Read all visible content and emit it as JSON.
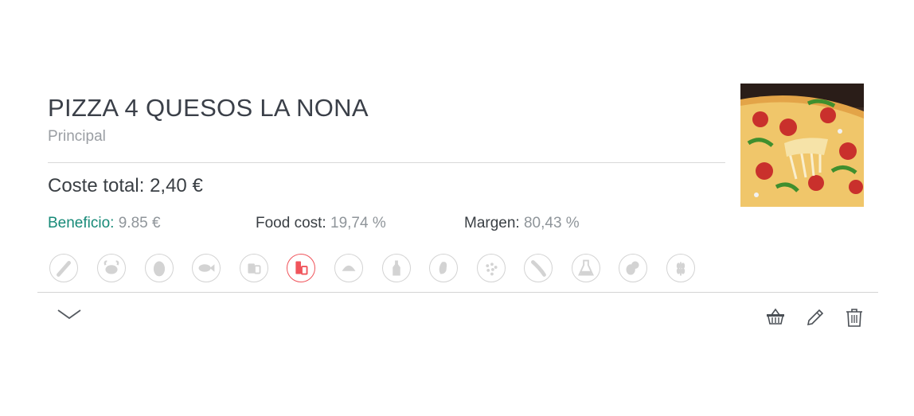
{
  "recipe": {
    "title": "PIZZA 4 QUESOS LA NONA",
    "category": "Principal",
    "total_cost_label": "Coste total: 2,40 €"
  },
  "metrics": [
    {
      "label": "Beneficio:",
      "value": "9.85 €"
    },
    {
      "label": "Food cost:",
      "value": "19,74 %"
    },
    {
      "label": "Margen:",
      "value": "80,43 %"
    }
  ],
  "allergens": [
    {
      "icon": "celery-icon",
      "active": false
    },
    {
      "icon": "crustaceans-icon",
      "active": false
    },
    {
      "icon": "egg-icon",
      "active": false
    },
    {
      "icon": "fish-icon",
      "active": false
    },
    {
      "icon": "sulphites-icon",
      "active": false
    },
    {
      "icon": "milk-icon",
      "active": true
    },
    {
      "icon": "molluscs-icon",
      "active": false
    },
    {
      "icon": "mustard-icon",
      "active": false
    },
    {
      "icon": "nuts-icon",
      "active": false
    },
    {
      "icon": "sesame-icon",
      "active": false
    },
    {
      "icon": "lupin-icon",
      "active": false
    },
    {
      "icon": "soy-icon",
      "active": false
    },
    {
      "icon": "peanut-icon",
      "active": false
    },
    {
      "icon": "gluten-icon",
      "active": false
    }
  ],
  "colors": {
    "accent": "#178a78",
    "active_allergen": "#f0545b",
    "inactive_allergen": "#d3d3d3"
  },
  "actions": [
    "basket-icon",
    "pencil-icon",
    "trash-icon"
  ]
}
